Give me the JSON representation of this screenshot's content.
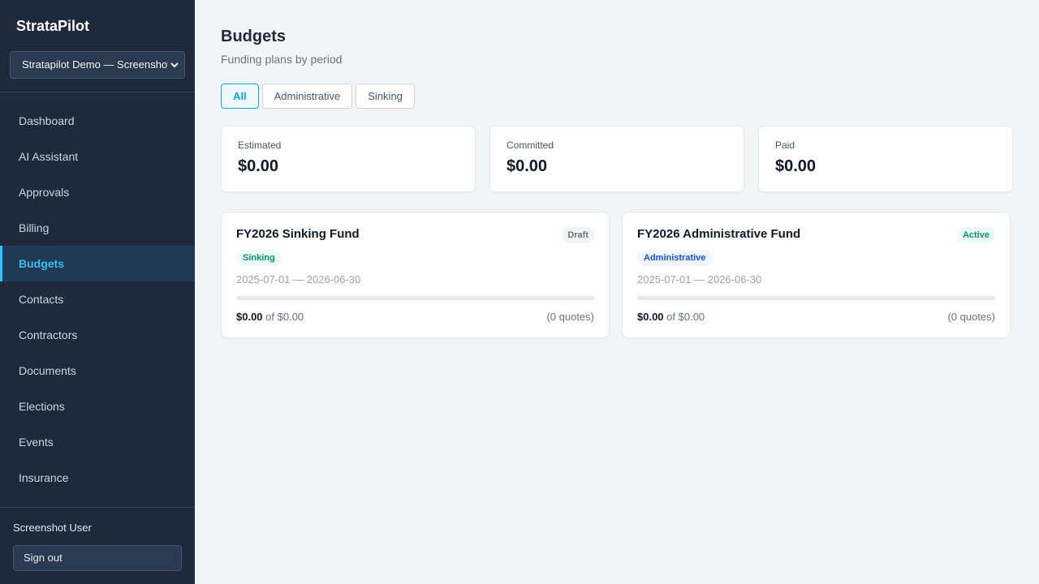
{
  "app": {
    "name": "StrataPilot",
    "org_selector": "Stratapilot Demo — Screenshots"
  },
  "sidebar": {
    "items": [
      {
        "label": "Dashboard",
        "active": false
      },
      {
        "label": "AI Assistant",
        "active": false
      },
      {
        "label": "Approvals",
        "active": false
      },
      {
        "label": "Billing",
        "active": false
      },
      {
        "label": "Budgets",
        "active": true
      },
      {
        "label": "Contacts",
        "active": false
      },
      {
        "label": "Contractors",
        "active": false
      },
      {
        "label": "Documents",
        "active": false
      },
      {
        "label": "Elections",
        "active": false
      },
      {
        "label": "Events",
        "active": false
      },
      {
        "label": "Insurance",
        "active": false
      }
    ],
    "user": "Screenshot User",
    "sign_out": "Sign out"
  },
  "page": {
    "title": "Budgets",
    "subtitle": "Funding plans by period"
  },
  "filters": [
    {
      "label": "All",
      "active": true
    },
    {
      "label": "Administrative",
      "active": false
    },
    {
      "label": "Sinking",
      "active": false
    }
  ],
  "stats": [
    {
      "label": "Estimated",
      "value": "$0.00"
    },
    {
      "label": "Committed",
      "value": "$0.00"
    },
    {
      "label": "Paid",
      "value": "$0.00"
    }
  ],
  "budgets": [
    {
      "name": "FY2026 Sinking Fund",
      "status": "Draft",
      "type": "Sinking",
      "dates": "2025-07-01 — 2026-06-30",
      "spent": "$0.00",
      "of_text": "of $0.00",
      "quotes": "(0 quotes)",
      "progress": 0
    },
    {
      "name": "FY2026 Administrative Fund",
      "status": "Active",
      "type": "Administrative",
      "dates": "2025-07-01 — 2026-06-30",
      "spent": "$0.00",
      "of_text": "of $0.00",
      "quotes": "(0 quotes)",
      "progress": 0
    }
  ],
  "icons": {
    "select_chevron": "chevron-down-icon"
  },
  "colors": {
    "sidebar_bg": "#1e293b",
    "accent": "#38bdf8",
    "primary": "#0ea5e9",
    "active_green": "#059669"
  }
}
